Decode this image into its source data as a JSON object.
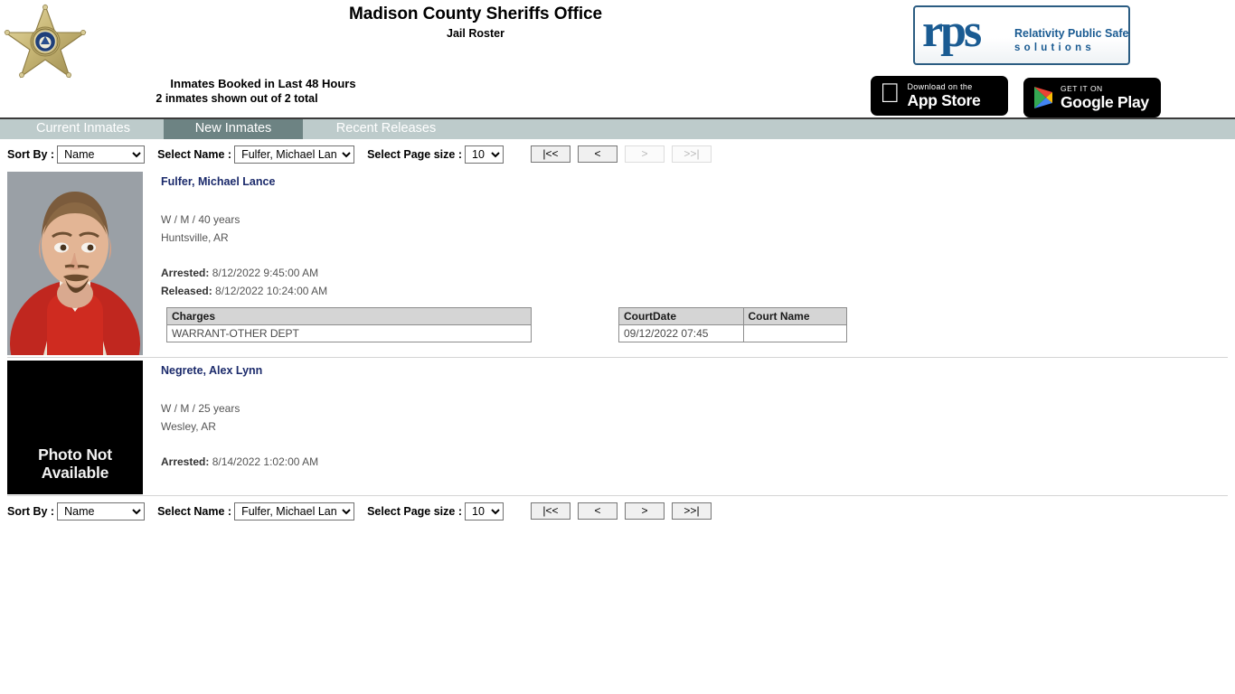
{
  "header": {
    "badge_icon": "sheriff-star-badge-icon",
    "title": "Madison County Sheriffs Office",
    "subtitle": "Jail Roster",
    "booked_heading": "Inmates Booked in Last 48 Hours",
    "booked_count": "2 inmates shown out of 2 total"
  },
  "branding": {
    "watermark": "rps",
    "logo_mark": "rps",
    "tagline_line1": "Relativity Public Safety",
    "tagline_line2": "solutions",
    "logo_color": "#1a5b92",
    "border_color": "#2b5c82",
    "app_store": {
      "small": "Download on the",
      "big": "App Store",
      "icon": "apple-logo-icon"
    },
    "google_play": {
      "small": "GET IT ON",
      "big": "Google Play",
      "icon": "google-play-triangle-icon"
    }
  },
  "tabs": [
    {
      "label": "Current Inmates",
      "active": false
    },
    {
      "label": "New Inmates",
      "active": true
    },
    {
      "label": "Recent Releases",
      "active": false
    }
  ],
  "tab_colors": {
    "bar": "#bdcbcb",
    "active": "#6d8383",
    "text": "#ffffff",
    "top_rule": "#3b3b3b"
  },
  "controls_top": {
    "sort_label": "Sort By :",
    "sort_value": "Name",
    "sort_options": [
      "Name"
    ],
    "name_label": "Select Name :",
    "name_value": "Fulfer, Michael Lance",
    "name_options": [
      "Fulfer, Michael Lance",
      "Negrete, Alex Lynn"
    ],
    "size_label": "Select Page size :",
    "size_value": "10",
    "size_options": [
      "10"
    ],
    "pager": [
      {
        "label": "|<<",
        "name": "first-page-button",
        "disabled": false
      },
      {
        "label": "<",
        "name": "prev-page-button",
        "disabled": false
      },
      {
        "label": ">",
        "name": "next-page-button",
        "disabled": true
      },
      {
        "label": ">>|",
        "name": "last-page-button",
        "disabled": true
      }
    ]
  },
  "controls_bottom": {
    "sort_label": "Sort By :",
    "sort_value": "Name",
    "name_label": "Select Name :",
    "name_value": "Fulfer, Michael Lance",
    "size_label": "Select Page size :",
    "size_value": "10",
    "pager": [
      {
        "label": "|<<",
        "name": "first-page-button",
        "disabled": false
      },
      {
        "label": "<",
        "name": "prev-page-button",
        "disabled": false
      },
      {
        "label": ">",
        "name": "next-page-button",
        "disabled": false
      },
      {
        "label": ">>|",
        "name": "last-page-button",
        "disabled": false
      }
    ]
  },
  "records": [
    {
      "name": "Fulfer, Michael Lance",
      "demographics": "W / M / 40 years",
      "city_state": "Huntsville, AR",
      "arrested_label": "Arrested:",
      "arrested_value": "8/12/2022 9:45:00 AM",
      "released_label": "Released:",
      "released_value": "8/12/2022 10:24:00 AM",
      "has_photo": true,
      "charges": {
        "header": "Charges",
        "rows": [
          "WARRANT-OTHER DEPT"
        ]
      },
      "court": {
        "headers": [
          "CourtDate",
          "Court Name"
        ],
        "rows": [
          {
            "date": "09/12/2022 07:45",
            "name": ""
          }
        ]
      }
    },
    {
      "name": "Negrete, Alex Lynn",
      "demographics": "W / M / 25 years",
      "city_state": "Wesley, AR",
      "arrested_label": "Arrested:",
      "arrested_value": "8/14/2022 1:02:00 AM",
      "released_label": "",
      "released_value": "",
      "has_photo": false,
      "no_photo_line1": "Photo Not",
      "no_photo_line2": "Available",
      "charges": null,
      "court": null
    }
  ]
}
